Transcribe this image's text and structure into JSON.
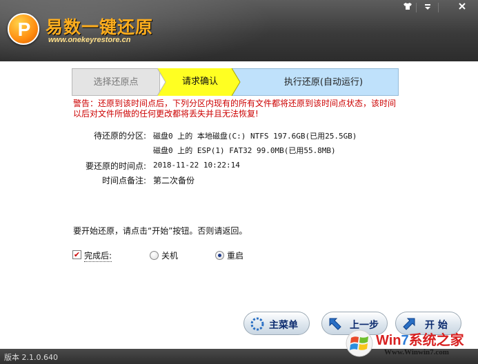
{
  "app": {
    "title": "易数一键还原",
    "url": "www.onekeyrestore.cn",
    "logo_glyph": "P"
  },
  "window_controls": [
    "shirt-icon",
    "menu-icon",
    "close-icon"
  ],
  "steps": [
    {
      "label": "选择还原点",
      "state": "done"
    },
    {
      "label": "请求确认",
      "state": "active"
    },
    {
      "label": "执行还原(自动运行)",
      "state": "pending"
    }
  ],
  "warning": "警告：还原到该时间点后，下列分区内现有的所有文件都将还原到该时间点状态，该时间以后对文件所做的任何更改都将丢失并且无法恢复!",
  "info": {
    "partition_label": "待还原的分区:",
    "partition_values": [
      "磁盘0 上的 本地磁盘(C:) NTFS 197.6GB(已用25.5GB)",
      "磁盘0 上的 ESP(1) FAT32 99.0MB(已用55.8MB)"
    ],
    "time_label": "要还原的时间点:",
    "time_value": "2018-11-22 10:22:14",
    "note_label": "时间点备注:",
    "note_value": "第二次备份"
  },
  "prompt": "要开始还原，请点击“开始”按钮。否则请返回。",
  "options": {
    "after_label": "完成后:",
    "after_checked": true,
    "shutdown_label": "关机",
    "restart_label": "重启",
    "selected": "restart"
  },
  "buttons": {
    "main_menu": "主菜单",
    "prev": "上一步",
    "start": "开 始"
  },
  "status": {
    "version": "版本 2.1.0.640"
  },
  "watermark": {
    "brand_prefix": "Win",
    "brand_seven": "7",
    "brand_suffix": "系统之家",
    "url": "Www.Winwin7.com"
  },
  "colors": {
    "active_step": "#ffff22",
    "pending_step": "#bfe1fb",
    "warning_text": "#cc0000",
    "title_orange": "#ffae1e"
  }
}
